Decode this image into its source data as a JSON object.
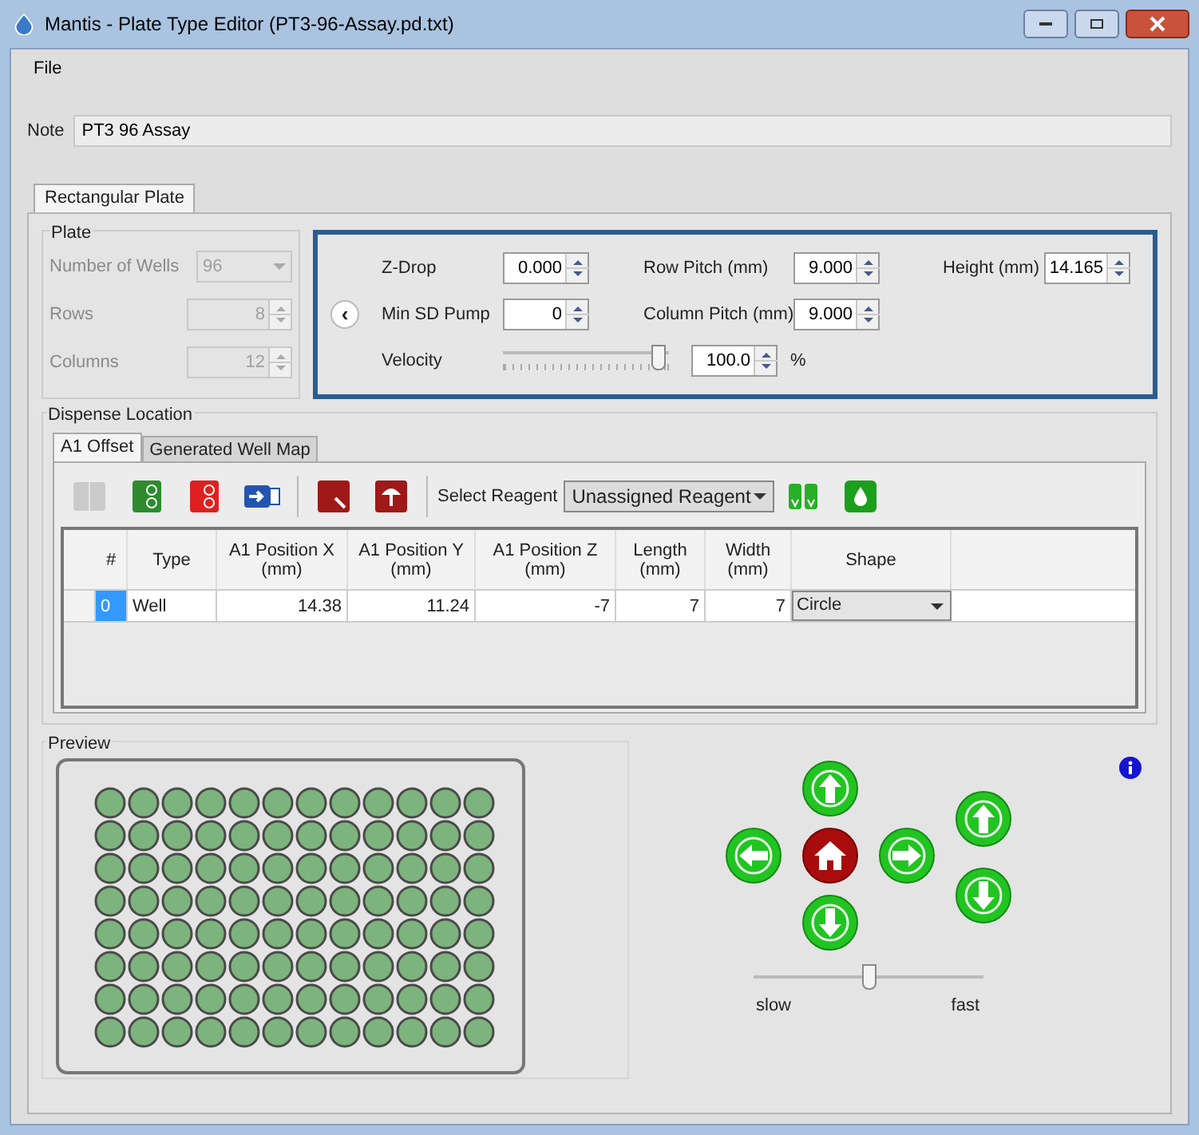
{
  "window": {
    "title": "Mantis - Plate Type Editor (PT3-96-Assay.pd.txt)"
  },
  "menu": [
    "File"
  ],
  "note": {
    "label": "Note",
    "value": "PT3 96 Assay"
  },
  "tabs": [
    {
      "label": "Rectangular Plate",
      "selected": true
    }
  ],
  "plate": {
    "title": "Plate",
    "fields": [
      {
        "label": "Number of Wells",
        "value": "96",
        "kind": "dropdown",
        "disabled": true
      },
      {
        "label": "Rows",
        "value": "8",
        "kind": "spinner",
        "disabled": true
      },
      {
        "label": "Columns",
        "value": "12",
        "kind": "spinner",
        "disabled": true
      }
    ]
  },
  "settings": {
    "collapse": "‹",
    "fields": [
      {
        "label": "Z-Drop",
        "value": "0.000"
      },
      {
        "label": "Row Pitch (mm)",
        "value": "9.000"
      },
      {
        "label": "Height (mm)",
        "value": "14.165"
      },
      {
        "label": "Min SD Pump",
        "value": "0"
      },
      {
        "label": "Column Pitch (mm)",
        "value": "9.000"
      }
    ],
    "velocity": {
      "label": "Velocity",
      "level": 0.97,
      "value": "100.0",
      "unit": "%"
    }
  },
  "dispense": {
    "title": "Dispense Location",
    "tabs": [
      {
        "label": "A1 Offset",
        "selected": true
      },
      {
        "label": "Generated Well Map",
        "selected": false
      }
    ],
    "toolbar": [
      {
        "kind": "split",
        "disabled": true
      },
      {
        "kind": "green-plate",
        "disabled": false
      },
      {
        "kind": "red-plate",
        "disabled": false
      },
      {
        "kind": "import",
        "disabled": false
      },
      {
        "kind": "separator"
      },
      {
        "kind": "red-search",
        "disabled": false
      },
      {
        "kind": "red-upload",
        "disabled": false
      },
      {
        "kind": "separator"
      }
    ],
    "reagent": {
      "label": "Select Reagent",
      "value": "Unassigned Reagent"
    },
    "toolbar_after": [
      {
        "kind": "nozzles",
        "disabled": false
      },
      {
        "kind": "drop",
        "disabled": false
      }
    ],
    "table": {
      "columns": [
        "#",
        "Type",
        "A1 Position X\n(mm)",
        "A1 Position Y\n(mm)",
        "A1 Position Z\n(mm)",
        "Length\n(mm)",
        "Width\n(mm)",
        "Shape"
      ],
      "rows": [
        {
          "selected": true,
          "cells": [
            "0",
            "Well",
            "14.38",
            "11.24",
            "-7",
            "7",
            "7",
            "Circle"
          ]
        }
      ]
    }
  },
  "preview": {
    "title": "Preview"
  },
  "jog": {
    "speed": {
      "level": 0.5,
      "min_label": "slow",
      "max_label": "fast"
    }
  }
}
